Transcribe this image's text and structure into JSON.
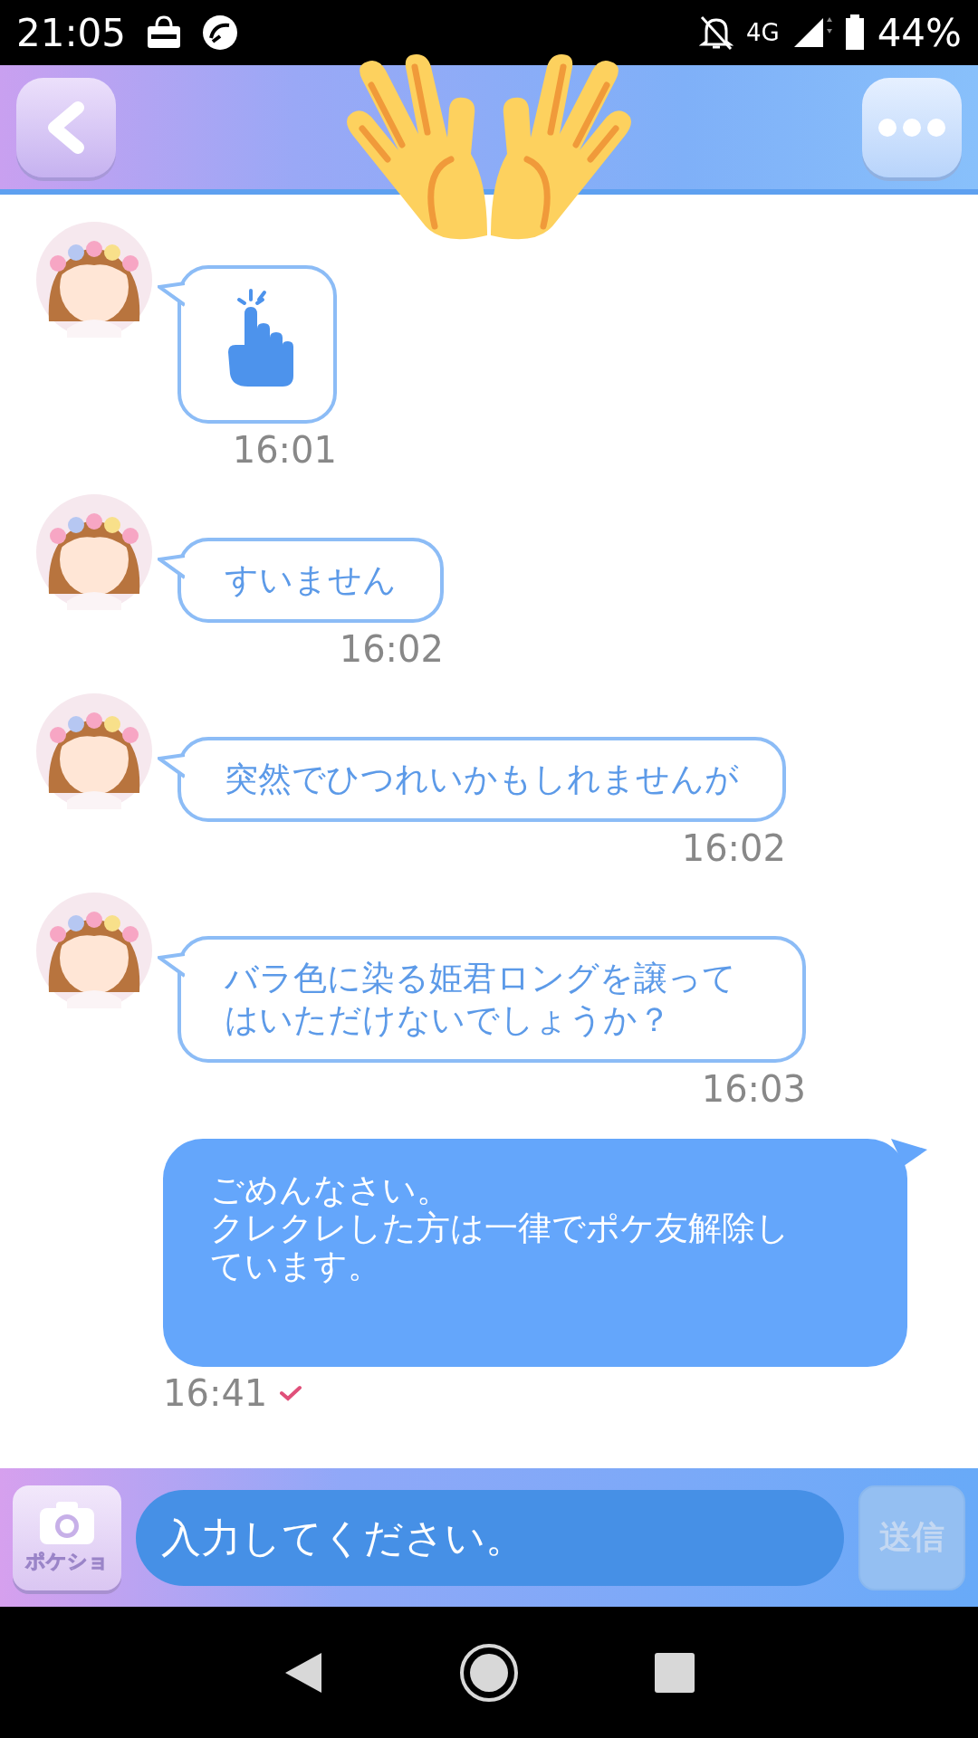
{
  "status_bar": {
    "time": "21:05",
    "network": "4G",
    "battery": "44%"
  },
  "messages": [
    {
      "outgoing": false,
      "kind": "sticker",
      "time": "16:01"
    },
    {
      "outgoing": false,
      "kind": "text",
      "lines": [
        "すいません"
      ],
      "time": "16:02"
    },
    {
      "outgoing": false,
      "kind": "text",
      "lines": [
        "突然でひつれいかもしれませんが"
      ],
      "time": "16:02"
    },
    {
      "outgoing": false,
      "kind": "text",
      "lines": [
        "バラ色に染る姫君ロングを譲ってはいただけないでしょうか？"
      ],
      "time": "16:03"
    },
    {
      "outgoing": true,
      "kind": "text",
      "lines": [
        "ごめんなさい。",
        "クレクレした方は一律でポケ友解除しています。"
      ],
      "time": "16:41",
      "read": true
    }
  ],
  "input_bar": {
    "camera_label": "ポケショ",
    "placeholder": "入力してください。",
    "send_label": "送信",
    "send_disabled": true
  }
}
